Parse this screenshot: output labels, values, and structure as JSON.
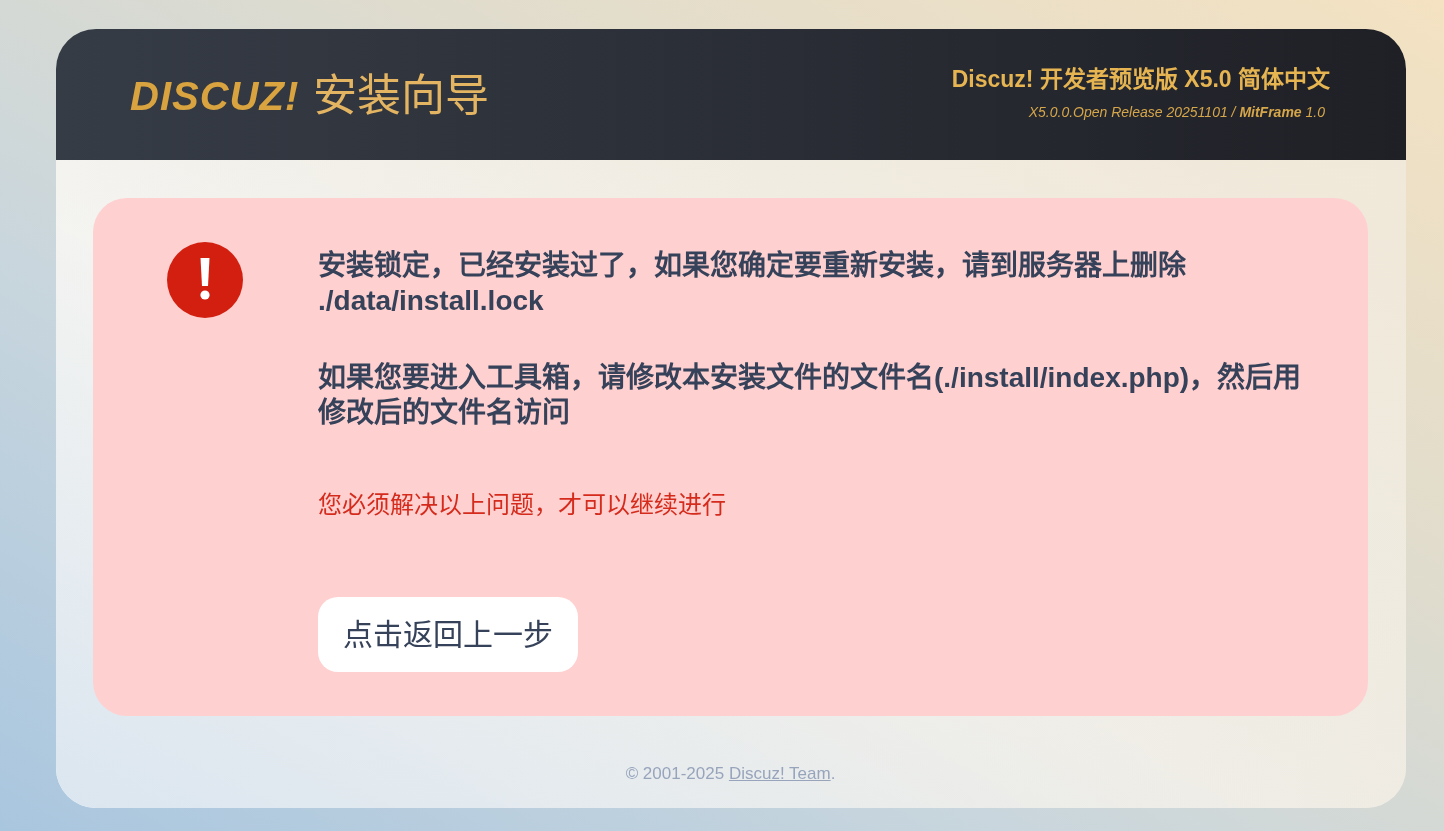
{
  "header": {
    "logo": "DISCUZ!",
    "title": "安装向导",
    "product": "Discuz! 开发者预览版 X5.0 简体中文",
    "release": "X5.0.0.Open Release 20251101 / **MitFrame**  1.0"
  },
  "alert": {
    "messages": [
      "安装锁定，已经安装过了，如果您确定要重新安装，请到服务器上删除 ./data/install.lock",
      "如果您要进入工具箱，请修改本安装文件的文件名(./install/index.php)，然后用修改后的文件名访问"
    ],
    "notice": "您必须解决以上问题，才可以继续进行",
    "button": "点击返回上一步"
  },
  "footer": {
    "copyright": "© 2001-2025",
    "link": "Discuz! Team",
    "end": "."
  }
}
